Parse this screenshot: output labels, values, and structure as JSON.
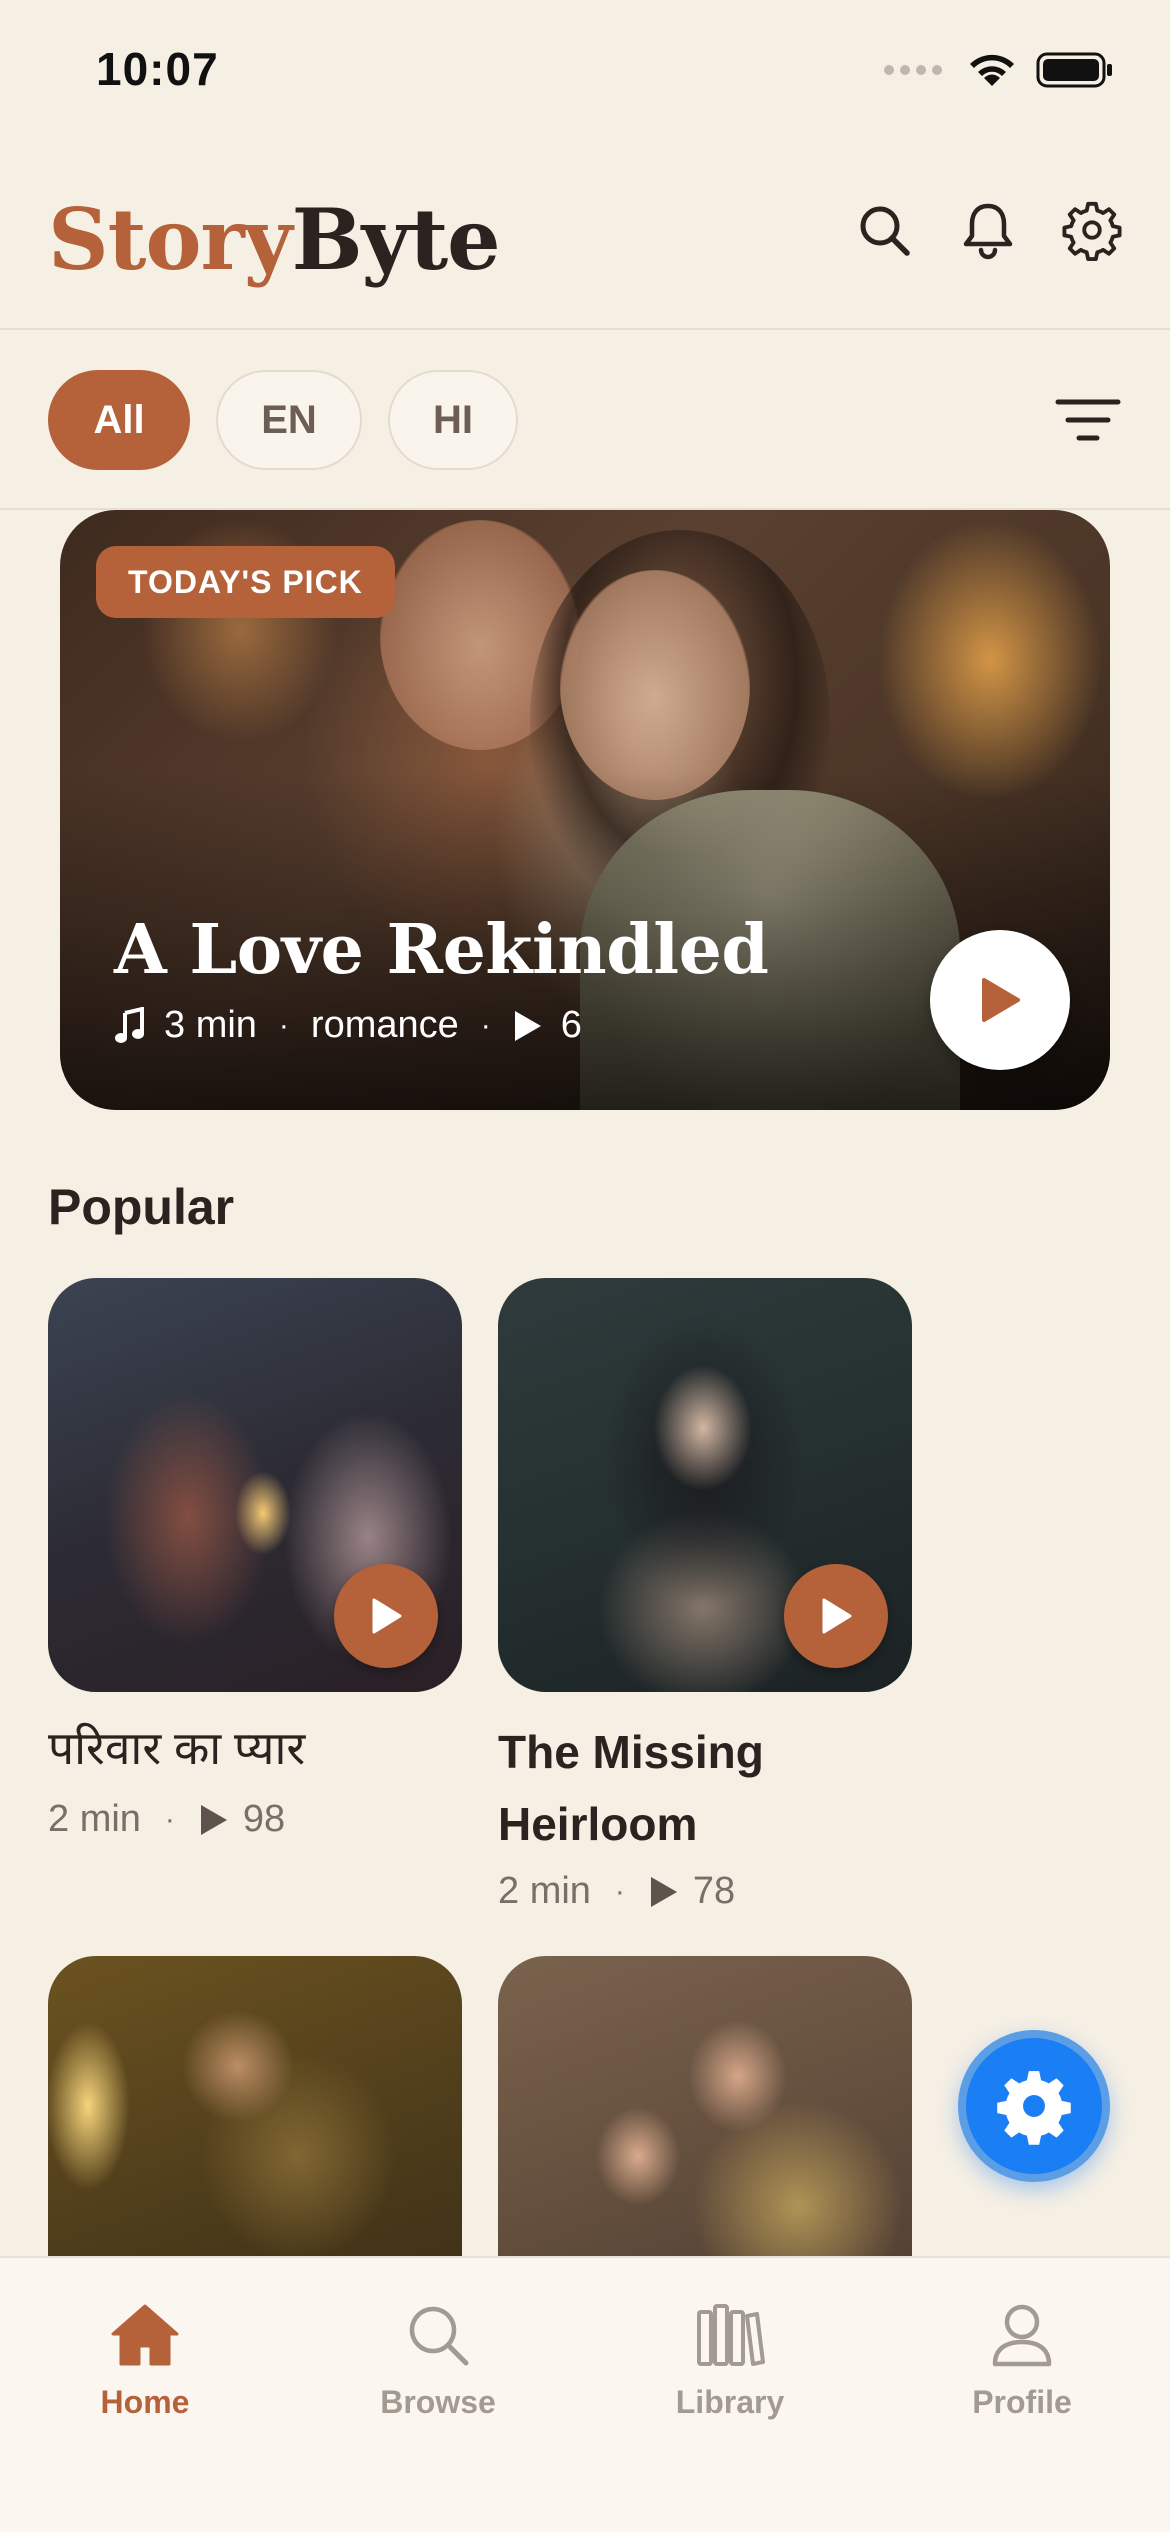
{
  "status_bar": {
    "time": "10:07"
  },
  "header": {
    "logo_part1": "Story",
    "logo_part2": "Byte",
    "icons": [
      "search-icon",
      "bell-icon",
      "gear-icon"
    ]
  },
  "filters": {
    "chips": [
      {
        "label": "All",
        "selected": true
      },
      {
        "label": "EN",
        "selected": false
      },
      {
        "label": "HI",
        "selected": false
      }
    ],
    "filter_icon": "filter-lines-icon"
  },
  "hero": {
    "badge": "TODAY'S PICK",
    "title": "A Love Rekindled",
    "duration": "3 min",
    "genre": "romance",
    "plays": "6"
  },
  "popular": {
    "title": "Popular",
    "items": [
      {
        "title": "परिवार का प्यार",
        "duration": "2 min",
        "plays": "98"
      },
      {
        "title": "The Missing Heirloom",
        "title_line1": "The Missing",
        "title_line2": "Heirloom",
        "duration": "2 min",
        "plays": "78"
      }
    ]
  },
  "colors": {
    "accent": "#B5613A",
    "background": "#F5EFE4",
    "fab": "#1A7EF5"
  },
  "bottom_nav": {
    "items": [
      {
        "label": "Home",
        "icon": "home-icon",
        "active": true
      },
      {
        "label": "Browse",
        "icon": "search-icon",
        "active": false
      },
      {
        "label": "Library",
        "icon": "library-icon",
        "active": false
      },
      {
        "label": "Profile",
        "icon": "profile-icon",
        "active": false
      }
    ]
  }
}
